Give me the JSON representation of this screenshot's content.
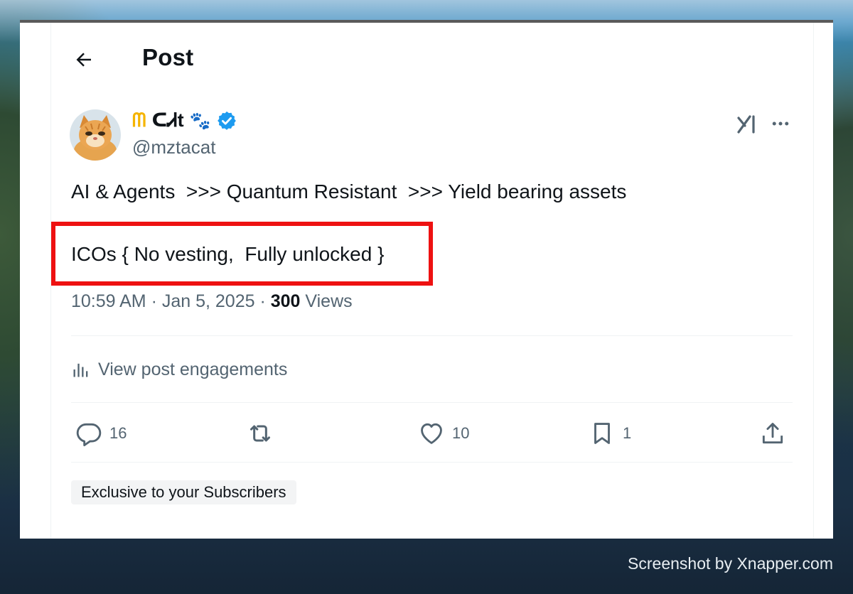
{
  "header": {
    "title": "Post"
  },
  "author": {
    "display_name_deco": "ᗰ",
    "display_name": "ᑕᏗt",
    "paw_emoji": "🐾",
    "handle": "@mztacat",
    "verified": true
  },
  "post": {
    "line1": "AI & Agents  >>> Quantum Resistant  >>> Yield bearing assets",
    "line2": "ICOs { No vesting,  Fully unlocked }",
    "time": "10:59 AM · Jan 5, 2025 · ",
    "views_count": "300",
    "views_label": " Views"
  },
  "engagements": {
    "label": "View post engagements"
  },
  "actions": {
    "replies": "16",
    "likes": "10",
    "bookmarks": "1"
  },
  "badge": {
    "label": "Exclusive to your Subscribers"
  },
  "watermark": {
    "label": "Screenshot by Xnapper.com"
  },
  "icons": {
    "back": "arrow-left-icon",
    "grok": "grok-icon",
    "more": "more-icon",
    "verified": "verified-badge-icon",
    "analytics": "analytics-icon",
    "reply": "reply-icon",
    "retweet": "retweet-icon",
    "like": "heart-icon",
    "bookmark": "bookmark-icon",
    "share": "share-icon"
  },
  "colors": {
    "highlight": "#ee1111",
    "verified": "#1d9bf0",
    "muted": "#536471"
  }
}
